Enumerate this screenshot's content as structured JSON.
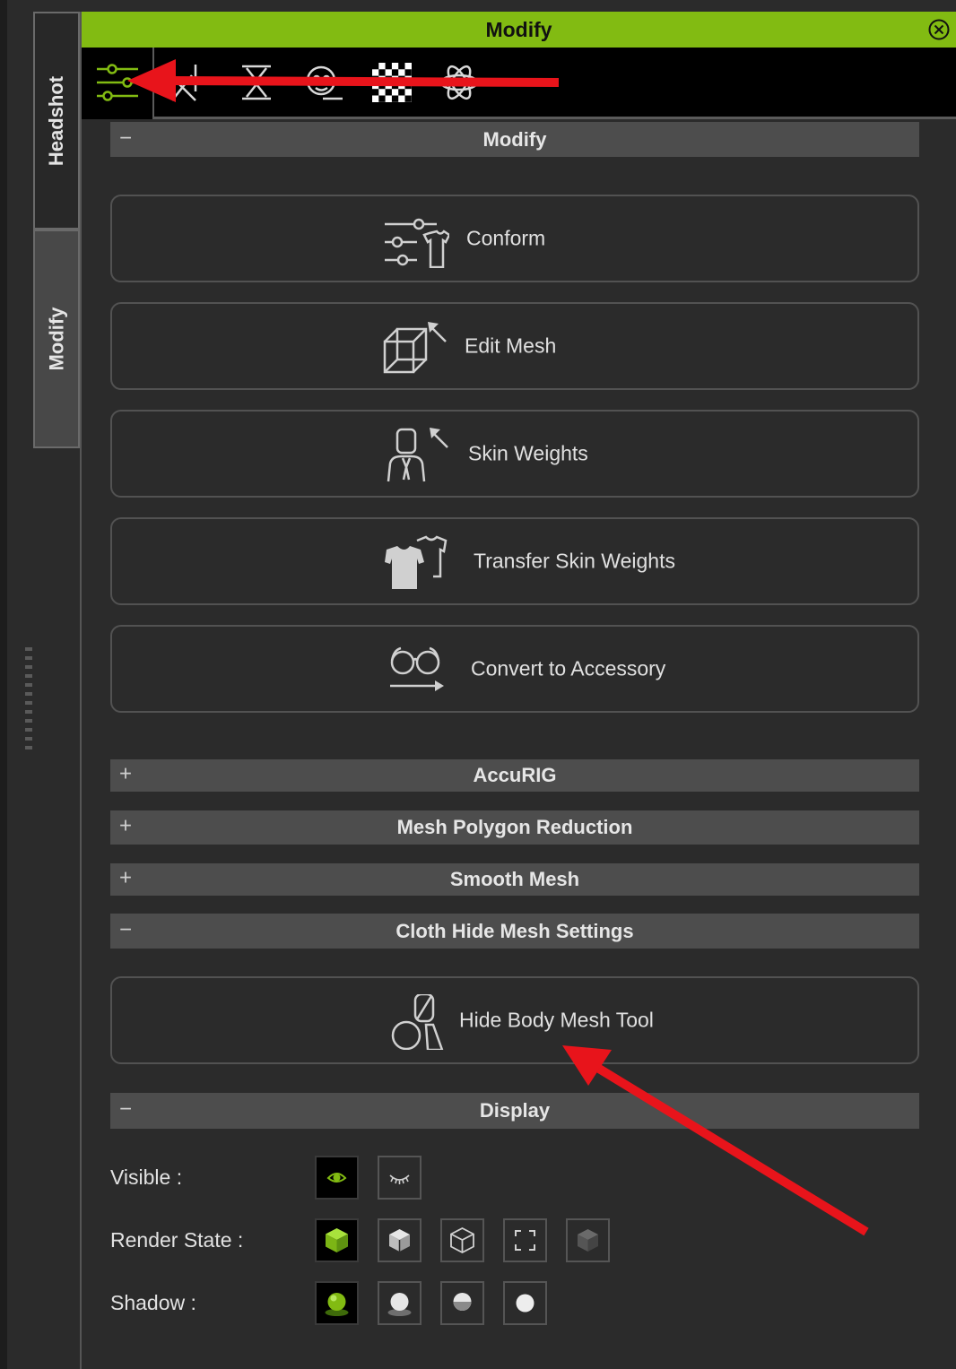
{
  "side_tabs": {
    "headshot": "Headshot",
    "modify": "Modify"
  },
  "panel": {
    "title": "Modify"
  },
  "toolbar": {
    "icons": [
      "modify-sliders-icon",
      "pose-icon",
      "hourglass-icon",
      "morph-head-icon",
      "checker-texture-icon",
      "physics-atom-icon"
    ]
  },
  "sections": {
    "modify": {
      "label": "Modify",
      "sign": "−"
    },
    "accurig": {
      "label": "AccuRIG",
      "sign": "+"
    },
    "mesh_polygon_reduction": {
      "label": "Mesh Polygon Reduction",
      "sign": "+"
    },
    "smooth_mesh": {
      "label": "Smooth Mesh",
      "sign": "+"
    },
    "cloth_hide_mesh": {
      "label": "Cloth Hide Mesh Settings",
      "sign": "−"
    },
    "display": {
      "label": "Display",
      "sign": "−"
    }
  },
  "buttons": {
    "conform": "Conform",
    "edit_mesh": "Edit Mesh",
    "skin_weights": "Skin Weights",
    "transfer_skin_weights": "Transfer Skin Weights",
    "convert_to_accessory": "Convert to Accessory",
    "hide_body_mesh_tool": "Hide Body Mesh Tool"
  },
  "display": {
    "visible_label": "Visible :",
    "render_state_label": "Render State  :",
    "shadow_label": "Shadow :"
  },
  "colors": {
    "accent": "#82bb12",
    "annotation_arrow": "#e8141b"
  }
}
